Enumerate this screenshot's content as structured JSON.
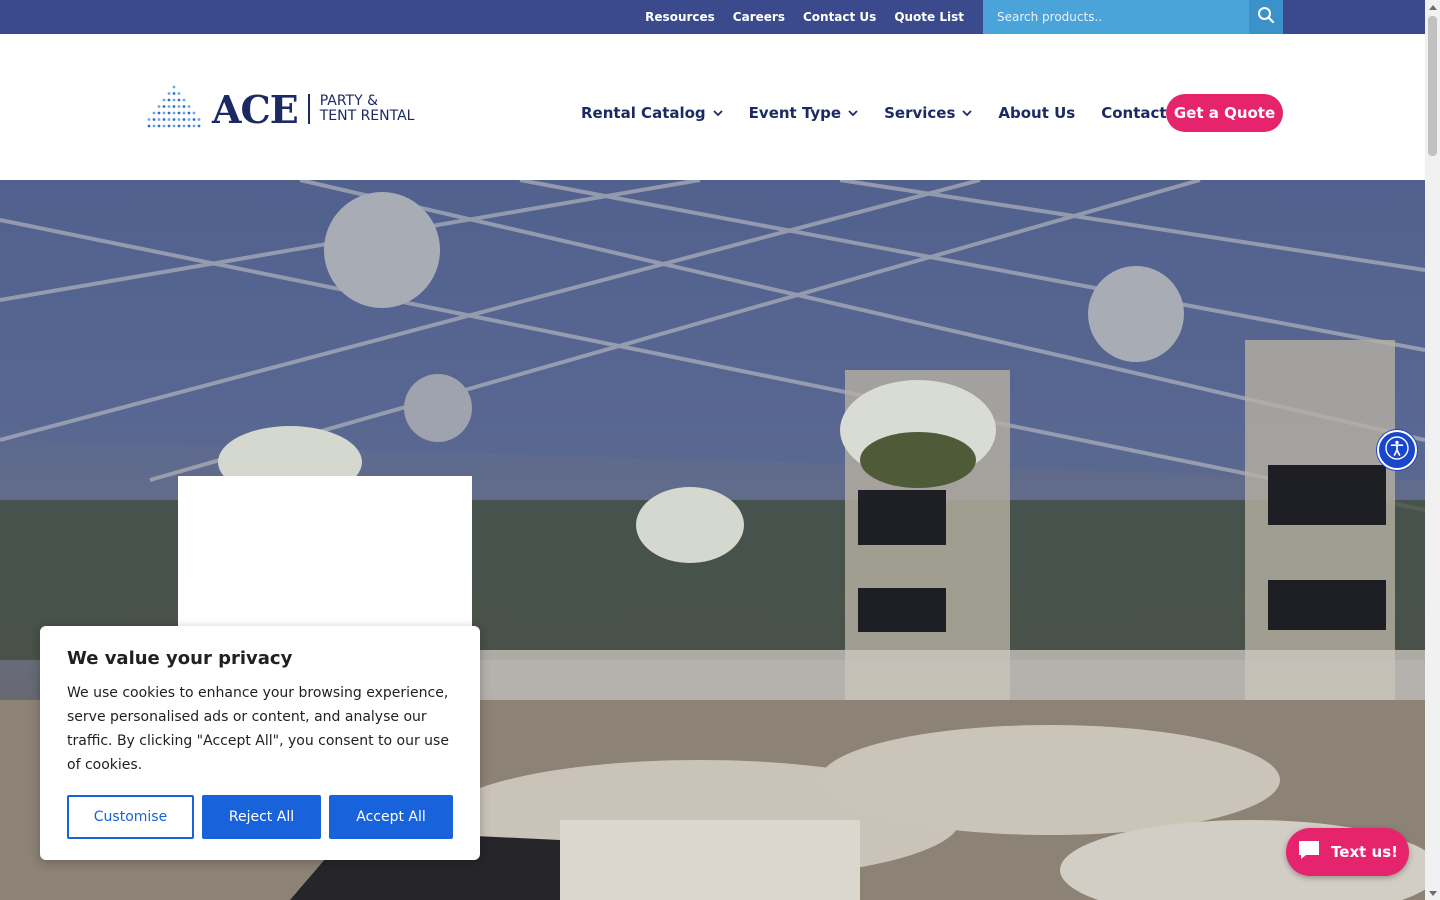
{
  "topbar": {
    "links": [
      "Resources",
      "Careers",
      "Contact Us",
      "Quote List"
    ],
    "search_placeholder": "Search products..",
    "search_icon": "search-icon"
  },
  "header": {
    "logo_main": "ACE",
    "logo_tag_line1": "PARTY &",
    "logo_tag_line2": "TENT RENTAL",
    "nav": [
      {
        "label": "Rental Catalog",
        "dropdown": true
      },
      {
        "label": "Event Type",
        "dropdown": true
      },
      {
        "label": "Services",
        "dropdown": true
      },
      {
        "label": "About Us",
        "dropdown": false
      },
      {
        "label": "Contact",
        "dropdown": false
      }
    ],
    "cta_label": "Get a Quote"
  },
  "cookie": {
    "title": "We value your privacy",
    "body": "We use cookies to enhance your browsing experience, serve personalised ads or content, and analyse our traffic. By clicking \"Accept All\", you consent to our use of cookies.",
    "customise": "Customise",
    "reject": "Reject All",
    "accept": "Accept All"
  },
  "widgets": {
    "text_us": "Text us!",
    "accessibility_icon": "accessibility-icon"
  },
  "colors": {
    "topbar": "#3a4a8c",
    "search": "#4aa3d9",
    "brand_navy": "#1c2a63",
    "brand_pink": "#e6246e",
    "cookie_blue": "#1863dc"
  }
}
